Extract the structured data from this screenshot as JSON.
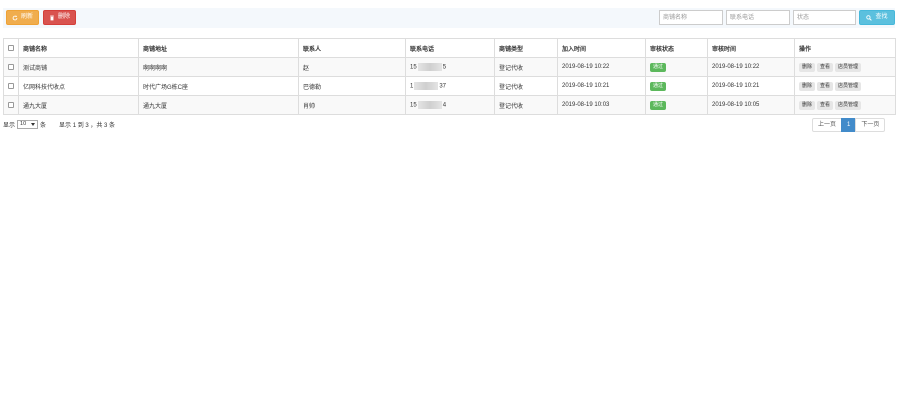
{
  "toolbar": {
    "refresh_label": "刷新",
    "delete_label": "删除",
    "filters": {
      "shop_name_placeholder": "商铺名称",
      "phone_placeholder": "联系电话",
      "status_placeholder": "状态"
    },
    "search_label": "查找"
  },
  "table": {
    "columns": [
      "商铺名称",
      "商铺地址",
      "联系人",
      "联系电话",
      "商铺类型",
      "加入时间",
      "审核状态",
      "审核时间",
      "操作"
    ],
    "rows": [
      {
        "name": "测试商铺",
        "address": "啊啊啊啊",
        "contact": "赵",
        "phone_prefix": "15",
        "phone_suffix": "5",
        "type": "登记代收",
        "join_time": "2019-08-19 10:22",
        "status": "通过",
        "review_time": "2019-08-19 10:22"
      },
      {
        "name": "亿网科技代收点",
        "address": "时代广场G栋C座",
        "contact": "巴德勒",
        "phone_prefix": "1",
        "phone_suffix": "37",
        "type": "登记代收",
        "join_time": "2019-08-19 10:21",
        "status": "通过",
        "review_time": "2019-08-19 10:21"
      },
      {
        "name": "通九大厦",
        "address": "通九大厦",
        "contact": "肖帅",
        "phone_prefix": "15",
        "phone_suffix": "4",
        "type": "登记代收",
        "join_time": "2019-08-19 10:03",
        "status": "通过",
        "review_time": "2019-08-19 10:05"
      }
    ],
    "actions": {
      "delete": "删除",
      "view": "查看",
      "staff": "店员管理"
    }
  },
  "pagination": {
    "show_label": "显示",
    "page_size": "10",
    "unit_label": "条",
    "summary": "显示 1 到 3 ，共 3 条",
    "prev": "上一页",
    "current_page": "1",
    "next": "下一页"
  },
  "colors": {
    "refresh": "#f0ad4e",
    "delete": "#d9534f",
    "search": "#5bc0de",
    "status_pass": "#5cb85c",
    "page_active": "#428bca"
  }
}
